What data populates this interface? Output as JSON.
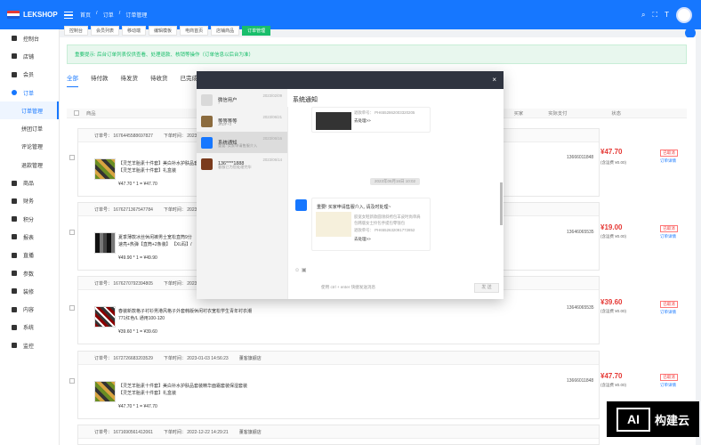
{
  "header": {
    "brand": "LEKSHOP",
    "breadcrumbs": [
      "首页",
      "/",
      "订单",
      "/",
      "订单管理"
    ],
    "icons": [
      "search-icon",
      "fullscreen-icon",
      "font-size-icon",
      "avatar-icon"
    ]
  },
  "sidebar": {
    "items": [
      {
        "label": "控制台"
      },
      {
        "label": "店铺"
      },
      {
        "label": "会员"
      },
      {
        "label": "订单"
      },
      {
        "label": "订单管理"
      },
      {
        "label": "拼团订单"
      },
      {
        "label": "评论管理"
      },
      {
        "label": "退款管理"
      },
      {
        "label": "商品"
      },
      {
        "label": "财务"
      },
      {
        "label": "积分"
      },
      {
        "label": "报表"
      },
      {
        "label": "直播"
      },
      {
        "label": "参数"
      },
      {
        "label": "装修"
      },
      {
        "label": "内容"
      },
      {
        "label": "系统"
      },
      {
        "label": "监控"
      }
    ]
  },
  "tabs": [
    "控制台",
    "会员列表",
    "移动端",
    "编辑模板",
    "电商首页",
    "店铺商品",
    "订单管理"
  ],
  "notice": "重要提示: 后台订单列表仅供查看、处理退款、核销等操作（订单信息以后台为准）",
  "status_tabs": [
    "全部",
    "待付款",
    "待发货",
    "待收货",
    "已完成"
  ],
  "table_head": {
    "goods": "商品",
    "buyer": "买家",
    "payment": "实际支付",
    "status": "状态"
  },
  "orders": [
    {
      "order_no": "订单号： 1676445588697827",
      "order_time": "下单时间： 2023-0",
      "desc1": "【灵芝羊胎素十件套】美白补水护肤品套装",
      "desc2": "【灵芝羊胎素十件套】礼盒装",
      "price": "¥47.70 * 1 = ¥47.70",
      "phone": "13666011848",
      "pay": "¥47.70",
      "fee": "(含运费 ¥0.00)",
      "status": "已取消",
      "detail": "订单详情"
    },
    {
      "order_no": "订单号： 1676271367547784",
      "order_time": "下单时间： 2023-0",
      "desc1": "夏季薄款冰丝休闲裤男士宽松直筒9分",
      "desc2": "速亮+热弹【直筒+2条装】 【XL码】/",
      "price": "¥49.90 * 1 = ¥49.90",
      "phone": "13646065535",
      "pay": "¥19.00",
      "fee": "(含运费 ¥0.00)",
      "status": "已取消",
      "detail": "订单详情"
    },
    {
      "order_no": "订单号： 1676270792394805",
      "order_time": "下单时间： 2023-0",
      "desc1": "春装新款格子衬衫男港风格子外套韩版休闲衬衣宽松学生青年衬衣潮",
      "desc2": "771红色/L 通用100-120",
      "price": "¥39.60 * 1 = ¥39.60",
      "phone": "13646065535",
      "pay": "¥39.60",
      "fee": "(含运费 ¥0.00)",
      "status": "已取消",
      "detail": "订单详情"
    },
    {
      "order_no": "订单号： 1672726683203529",
      "order_time": "下单时间： 2023-01-03 14:56:23",
      "shop": "董客旗舰店",
      "desc1": "【灵芝羊胎素十件套】美白补水护肤品套装精华面霜套装保湿套装",
      "desc2": "【灵芝羊胎素十件套】礼盒装",
      "price": "¥47.70 * 1 = ¥47.70",
      "phone": "13666011848",
      "pay": "¥47.70",
      "fee": "(含运费 ¥0.00)",
      "status": "已取消",
      "detail": "订单详情"
    },
    {
      "order_no": "订单号： 1671690561412061",
      "order_time": "下单时间： 2022-12-22 14:29:21",
      "shop": "董客旗舰店"
    }
  ],
  "chat": {
    "list": [
      {
        "name": "微信用户",
        "date": "2023/02/09",
        "desc": "7"
      },
      {
        "name": "等等等等",
        "date": "2023/06/21",
        "desc": "JKDF+J"
      },
      {
        "name": "系统通知",
        "date": "2023/06/16",
        "desc": "重要: 买家申请售服介入"
      },
      {
        "name": "136****1888",
        "date": "2023/06/14",
        "desc": "客服已为您处理完毕"
      }
    ],
    "title": "系统通知",
    "message1": {
      "line1": "退款单号： PH6552862003320205",
      "link": "去处理>>"
    },
    "time": "2023年06月16日 10:02",
    "message2": {
      "headline": "重要! 买家申请售服介入, 请及时处理~",
      "line1": "胶宽女鞋新款圆领斜挎包羊皮时尚单肩",
      "line2": "包韩版女士拎包手提包零钱包",
      "line3": "退款单号： PH6552632091772852",
      "link": "去处理>>"
    },
    "tools": [
      "smile-icon",
      "image-icon"
    ],
    "hint": "使用 ctrl + enter 快捷发送消息",
    "send": "发 送"
  },
  "watermark": {
    "left": "AI",
    "right": "构建云"
  }
}
